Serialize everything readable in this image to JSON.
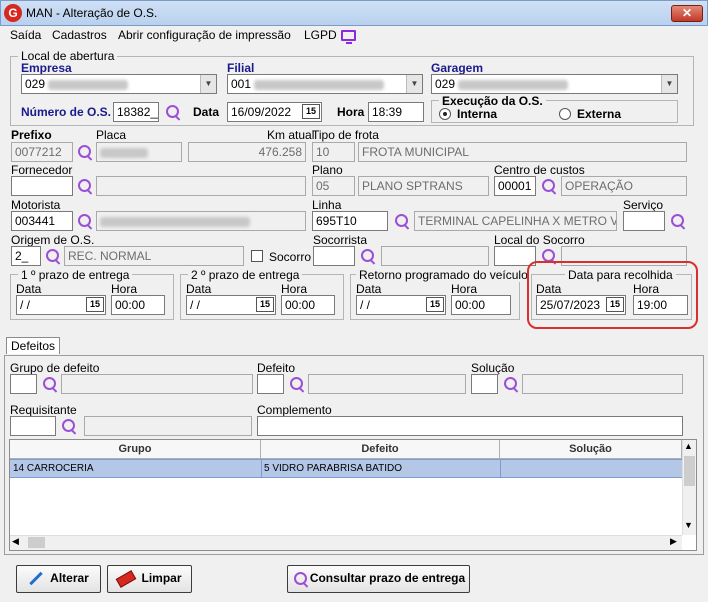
{
  "window": {
    "title": "MAN - Alteração de O.S.",
    "icon_letter": "G",
    "close_label": "✕"
  },
  "menu": [
    "Saída",
    "Cadastros",
    "Abrir configuração de impressão",
    "LGPD"
  ],
  "local_abertura": {
    "title": "Local de abertura",
    "empresa_label": "Empresa",
    "empresa_value": "029",
    "filial_label": "Filial",
    "filial_value": "001",
    "garagem_label": "Garagem",
    "garagem_value": "029"
  },
  "os": {
    "numero_label": "Número de O.S.",
    "numero_value": "18382__",
    "data_label": "Data",
    "data_value": "16/09/2022",
    "hora_label": "Hora",
    "hora_value": "18:39"
  },
  "execucao": {
    "title": "Execução da O.S.",
    "interna": "Interna",
    "externa": "Externa"
  },
  "vehicle": {
    "prefixo_label": "Prefixo",
    "prefixo_value": "0077212",
    "placa_label": "Placa",
    "km_label": "Km atual",
    "km_value": "476.258",
    "tipo_frota_label": "Tipo de frota",
    "tipo_frota_code": "10",
    "tipo_frota_desc": "FROTA MUNICIPAL"
  },
  "fornecedor": {
    "label": "Fornecedor",
    "plano_label": "Plano",
    "plano_code": "05",
    "plano_desc": "PLANO SPTRANS",
    "centro_label": "Centro de custos",
    "centro_code": "00001",
    "centro_desc": "OPERAÇÃO"
  },
  "motorista": {
    "label": "Motorista",
    "value": "003441",
    "linha_label": "Linha",
    "linha_code": "695T10",
    "linha_desc": "TERMINAL CAPELINHA X METRO VILA",
    "servico_label": "Serviço"
  },
  "origem": {
    "label": "Origem de O.S.",
    "code": "2_",
    "desc": "REC. NORMAL",
    "socorro_label": "Socorro",
    "socorrista_label": "Socorrista",
    "local_socorro_label": "Local do Socorro"
  },
  "prazos": {
    "data_label": "Data",
    "hora_label": "Hora",
    "p1_title": "1 º prazo de entrega",
    "p1_data": " / /",
    "p1_hora": "00:00",
    "p2_title": "2 º prazo de entrega",
    "p2_data": " / /",
    "p2_hora": "00:00",
    "ret_title": "Retorno programado do veículo",
    "ret_data": " / /",
    "ret_hora": "00:00",
    "rec_title": "Data para recolhida",
    "rec_data": "25/07/2023",
    "rec_hora": "19:00",
    "cal_glyph": "15"
  },
  "defeitos": {
    "tab_label": "Defeitos",
    "grupo_label": "Grupo de defeito",
    "defeito_label": "Defeito",
    "solucao_label": "Solução",
    "requisitante_label": "Requisitante",
    "complemento_label": "Complemento",
    "columns": [
      "Grupo",
      "Defeito",
      "Solução"
    ],
    "rows": [
      {
        "grupo": "14 CARROCERIA",
        "defeito": "5 VIDRO PARABRISA BATIDO",
        "solucao": ""
      }
    ]
  },
  "buttons": {
    "alterar": "Alterar",
    "limpar": "Limpar",
    "consultar": "Consultar prazo de entrega"
  }
}
